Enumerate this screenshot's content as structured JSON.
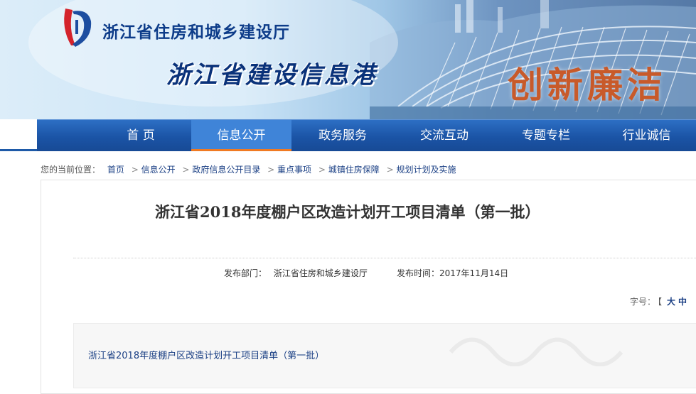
{
  "site": {
    "name": "浙江省住房和城乡建设厅",
    "slogan": "浙江省建设信息港",
    "motto": "创新廉洁"
  },
  "nav": {
    "items": [
      {
        "label": "首 页"
      },
      {
        "label": "信息公开"
      },
      {
        "label": "政务服务"
      },
      {
        "label": "交流互动"
      },
      {
        "label": "专题专栏"
      },
      {
        "label": "行业诚信"
      }
    ],
    "active_index": 1
  },
  "breadcrumb": {
    "prefix": "您的当前位置：",
    "items": [
      "首页",
      "信息公开",
      "政府信息公开目录",
      "重点事项",
      "城镇住房保障",
      "规划计划及实施"
    ],
    "separator": ">"
  },
  "article": {
    "title": "浙江省2018年度棚户区改造计划开工项目清单（第一批）",
    "publisher_label": "发布部门：",
    "publisher": "浙江省住房和城乡建设厅",
    "date_label": "发布时间：",
    "date": "2017年11月14日",
    "fontsize_label": "字号：",
    "fontsize_open": "【",
    "fontsize_options": [
      "大",
      "中"
    ],
    "attachment_link": "浙江省2018年度棚户区改造计划开工项目清单（第一批）"
  },
  "colors": {
    "nav_bg": "#1b54a6",
    "nav_active": "#3f84d8",
    "nav_active_underline": "#f07a22",
    "link": "#1a3f84",
    "motto": "#c85a2a"
  }
}
